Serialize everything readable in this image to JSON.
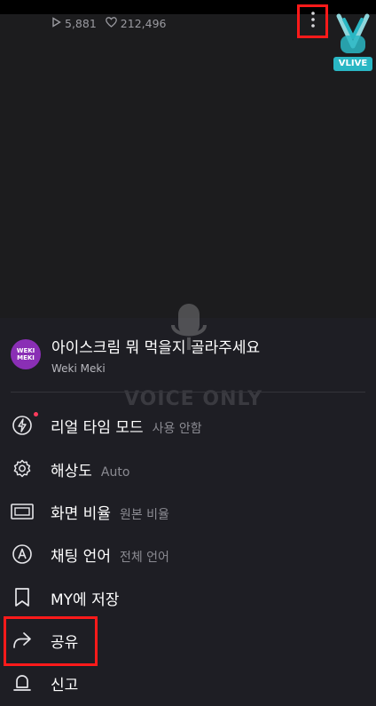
{
  "player": {
    "views": "5,881",
    "likes": "212,496",
    "voice_only_text": "VOICE ONLY",
    "logo_text": "VLIVE"
  },
  "video": {
    "title": "아이스크림 뭐 먹을지 골라주세요",
    "channel": "Weki Meki",
    "avatar_text_line1": "WEKI",
    "avatar_text_line2": "MEKI"
  },
  "menu": {
    "items": [
      {
        "label": "리얼 타임 모드",
        "value": "사용 안함"
      },
      {
        "label": "해상도",
        "value": "Auto"
      },
      {
        "label": "화면 비율",
        "value": "원본 비율"
      },
      {
        "label": "채팅 언어",
        "value": "전체 언어"
      },
      {
        "label": "MY에 저장",
        "value": ""
      },
      {
        "label": "공유",
        "value": ""
      },
      {
        "label": "신고",
        "value": ""
      }
    ]
  },
  "colors": {
    "accent_highlight": "#ff1a1a",
    "brand": "#2ab7c4",
    "avatar_bg": "#8a2fb5"
  }
}
